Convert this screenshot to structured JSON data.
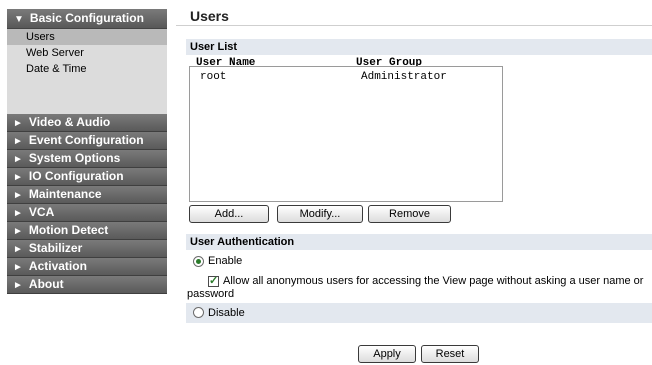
{
  "sidebar": {
    "header": {
      "arrow": "▼",
      "label": "Basic Configuration"
    },
    "sub_items": [
      {
        "label": "Users",
        "selected": true
      },
      {
        "label": "Web Server",
        "selected": false
      },
      {
        "label": "Date & Time",
        "selected": false
      }
    ],
    "sections": [
      {
        "arrow": "►",
        "label": "Video & Audio"
      },
      {
        "arrow": "►",
        "label": "Event Configuration"
      },
      {
        "arrow": "►",
        "label": "System Options"
      },
      {
        "arrow": "►",
        "label": "IO Configuration"
      },
      {
        "arrow": "►",
        "label": "Maintenance"
      },
      {
        "arrow": "►",
        "label": "VCA"
      },
      {
        "arrow": "►",
        "label": "Motion Detect"
      },
      {
        "arrow": "►",
        "label": "Stabilizer"
      },
      {
        "arrow": "►",
        "label": "Activation"
      },
      {
        "arrow": "►",
        "label": "About"
      }
    ]
  },
  "main": {
    "title": "Users",
    "user_list": {
      "heading": "User List",
      "col_name": "User Name",
      "col_group": "User Group",
      "rows": [
        {
          "name": "root",
          "group": "Administrator"
        }
      ]
    },
    "buttons": {
      "add": "Add...",
      "modify": "Modify...",
      "remove": "Remove"
    },
    "auth": {
      "heading": "User Authentication",
      "enable_label": "Enable",
      "enable_checked": true,
      "anon_line1": "Allow all anonymous users for accessing the View page without asking a user name or",
      "anon_line2": "password",
      "anon_checked": true,
      "disable_label": "Disable",
      "disable_checked": false
    },
    "footer": {
      "apply": "Apply",
      "reset": "Reset"
    }
  },
  "colors": {
    "sidebar_dark": "#5a5a5a",
    "sidebar_light": "#dcdcdc",
    "section_bar": "#e3e8ef",
    "radio_check": "#2a7a2a"
  }
}
